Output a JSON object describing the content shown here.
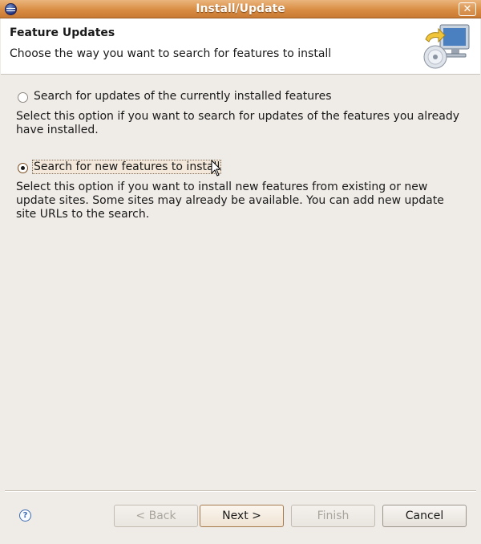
{
  "window": {
    "title": "Install/Update"
  },
  "banner": {
    "title": "Feature Updates",
    "description": "Choose the way you want to search for features to install"
  },
  "options": [
    {
      "label": "Search for updates of the currently installed features",
      "checked": false,
      "description": "Select this option if you want to search for updates of the features you already have installed."
    },
    {
      "label": "Search for new features to install",
      "checked": true,
      "description": "Select this option if you want to install new features from existing or new update sites. Some sites may already be available. You can add new update site URLs to the search."
    }
  ],
  "buttons": {
    "back": "< Back",
    "next": "Next >",
    "finish": "Finish",
    "cancel": "Cancel"
  },
  "help": {
    "glyph": "?"
  }
}
